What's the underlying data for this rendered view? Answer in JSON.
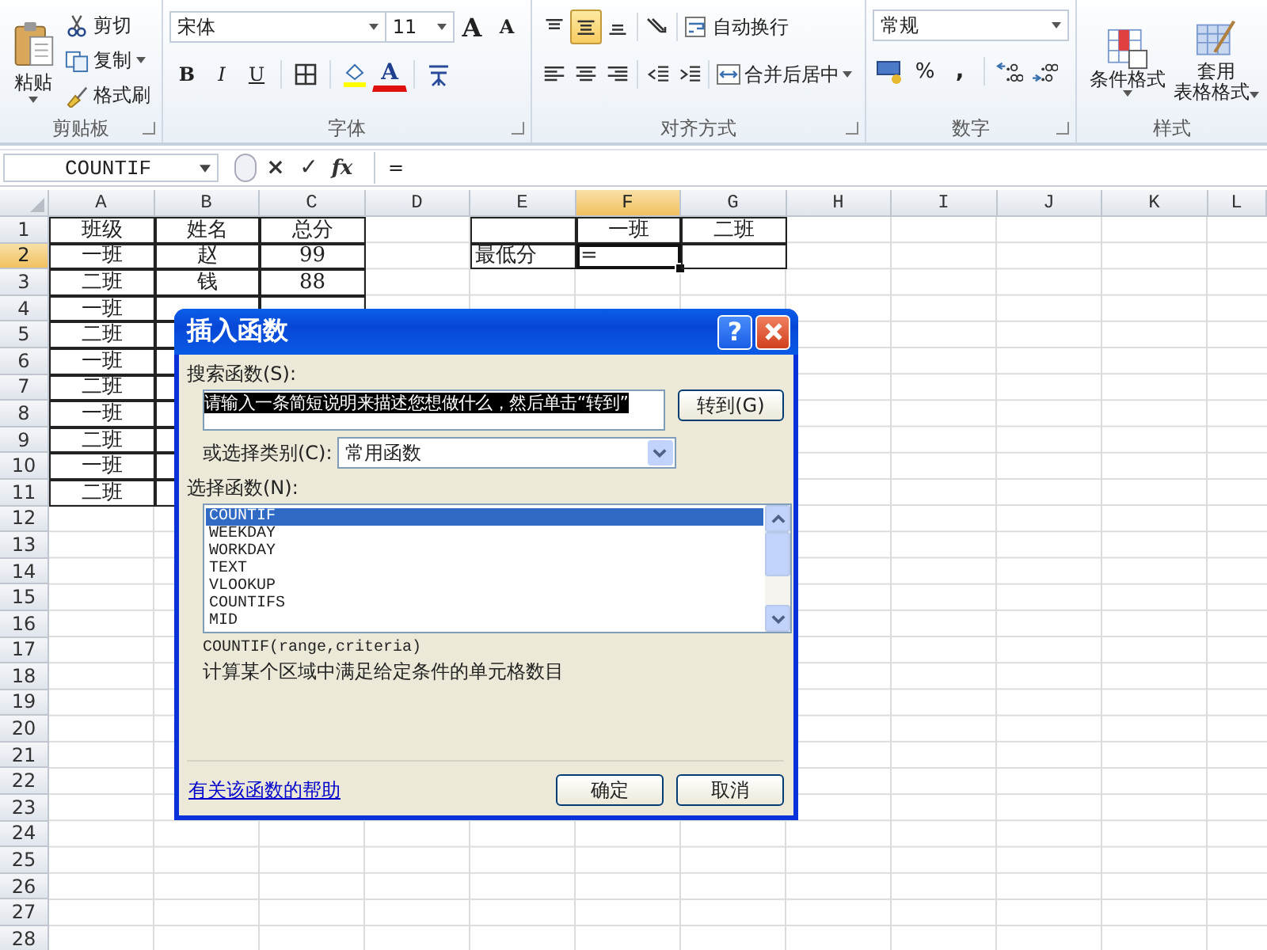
{
  "ribbon": {
    "clipboard": {
      "label": "剪贴板",
      "paste": "粘贴",
      "cut": "剪切",
      "copy": "复制",
      "painter": "格式刷"
    },
    "font": {
      "label": "字体",
      "font_name": "宋体",
      "font_size": "11",
      "grow": "A",
      "shrink": "A",
      "bold": "B",
      "italic": "I",
      "underline": "U",
      "font_color": "A"
    },
    "alignment": {
      "label": "对齐方式",
      "vertical": [
        {
          "kind": "top",
          "selected": false
        },
        {
          "kind": "middle",
          "selected": true
        },
        {
          "kind": "bottom",
          "selected": false
        }
      ],
      "horizontal": [
        {
          "kind": "left",
          "selected": false
        },
        {
          "kind": "center",
          "selected": false
        },
        {
          "kind": "right",
          "selected": false
        }
      ],
      "wrap": "自动换行",
      "merge": "合并后居中"
    },
    "number": {
      "label": "数字",
      "format": "常规",
      "percent": "%",
      "comma": ","
    },
    "styles": {
      "label": "样式",
      "conditional": "条件格式",
      "table_format": [
        "套用",
        "表格格式"
      ]
    }
  },
  "formula_bar": {
    "name_box": "COUNTIF",
    "cancel": "×",
    "enter": "✓",
    "fx": "fx",
    "formula": "="
  },
  "sheet": {
    "columns": [
      {
        "letter": "A",
        "selected": false
      },
      {
        "letter": "B",
        "selected": false
      },
      {
        "letter": "C",
        "selected": false
      },
      {
        "letter": "D",
        "selected": false
      },
      {
        "letter": "E",
        "selected": false
      },
      {
        "letter": "F",
        "selected": true
      },
      {
        "letter": "G",
        "selected": false
      },
      {
        "letter": "H",
        "selected": false
      },
      {
        "letter": "I",
        "selected": false
      },
      {
        "letter": "J",
        "selected": false
      },
      {
        "letter": "K",
        "selected": false
      },
      {
        "letter": "L",
        "selected": false
      }
    ],
    "rows": [
      {
        "number": "1",
        "selected": false,
        "cells": [
          {
            "text": "班级",
            "bordered": true,
            "active": false
          },
          {
            "text": "姓名",
            "bordered": true,
            "active": false
          },
          {
            "text": "总分",
            "bordered": true,
            "active": false
          },
          {
            "bordered": false,
            "active": false
          },
          {
            "bordered": true,
            "active": false
          },
          {
            "text": "一班",
            "bordered": true,
            "active": false
          },
          {
            "text": "二班",
            "bordered": true,
            "active": false
          }
        ]
      },
      {
        "number": "2",
        "selected": true,
        "cells": [
          {
            "text": "一班",
            "bordered": true,
            "active": false
          },
          {
            "text": "赵",
            "bordered": true,
            "active": false
          },
          {
            "text": "99",
            "bordered": true,
            "active": false
          },
          {
            "bordered": false,
            "active": false
          },
          {
            "text": "最低分",
            "bordered": true,
            "active": false
          },
          {
            "text": "=",
            "bordered": true,
            "active": true
          },
          {
            "bordered": true,
            "active": false
          }
        ]
      },
      {
        "number": "3",
        "selected": false,
        "cells": [
          {
            "text": "二班",
            "bordered": true,
            "active": false
          },
          {
            "text": "钱",
            "bordered": true,
            "active": false
          },
          {
            "text": "88",
            "bordered": true,
            "active": false
          }
        ]
      },
      {
        "number": "4",
        "selected": false,
        "cells": [
          {
            "text": "一班",
            "bordered": true,
            "active": false
          },
          {
            "bordered": true,
            "active": false
          },
          {
            "bordered": true,
            "active": false
          }
        ]
      },
      {
        "number": "5",
        "selected": false,
        "cells": [
          {
            "text": "二班",
            "bordered": true,
            "active": false
          },
          {
            "bordered": true,
            "active": false
          }
        ]
      },
      {
        "number": "6",
        "selected": false,
        "cells": [
          {
            "text": "一班",
            "bordered": true,
            "active": false
          },
          {
            "bordered": true,
            "active": false
          }
        ]
      },
      {
        "number": "7",
        "selected": false,
        "cells": [
          {
            "text": "二班",
            "bordered": true,
            "active": false
          },
          {
            "bordered": true,
            "active": false
          }
        ]
      },
      {
        "number": "8",
        "selected": false,
        "cells": [
          {
            "text": "一班",
            "bordered": true,
            "active": false
          },
          {
            "bordered": true,
            "active": false
          }
        ]
      },
      {
        "number": "9",
        "selected": false,
        "cells": [
          {
            "text": "二班",
            "bordered": true,
            "active": false
          },
          {
            "bordered": true,
            "active": false
          }
        ]
      },
      {
        "number": "10",
        "selected": false,
        "cells": [
          {
            "text": "一班",
            "bordered": true,
            "active": false
          },
          {
            "bordered": true,
            "active": false
          }
        ]
      },
      {
        "number": "11",
        "selected": false,
        "cells": [
          {
            "text": "二班",
            "bordered": true,
            "active": false
          },
          {
            "bordered": true,
            "active": false
          }
        ]
      },
      {
        "number": "12",
        "selected": false
      },
      {
        "number": "13",
        "selected": false
      },
      {
        "number": "14",
        "selected": false
      },
      {
        "number": "15",
        "selected": false
      },
      {
        "number": "16",
        "selected": false
      },
      {
        "number": "17",
        "selected": false
      },
      {
        "number": "18",
        "selected": false
      },
      {
        "number": "19",
        "selected": false
      },
      {
        "number": "20",
        "selected": false
      },
      {
        "number": "21",
        "selected": false
      },
      {
        "number": "22",
        "selected": false
      },
      {
        "number": "23",
        "selected": false
      },
      {
        "number": "24",
        "selected": false
      },
      {
        "number": "25",
        "selected": false
      },
      {
        "number": "26",
        "selected": false
      },
      {
        "number": "27",
        "selected": false
      },
      {
        "number": "28",
        "selected": false
      }
    ]
  },
  "dialog": {
    "title": "插入函数",
    "help": "?",
    "search_label": "搜索函数(S):",
    "search_value": "请输入一条简短说明来描述您想做什么，然后单击“转到”",
    "go": "转到(G)",
    "category_label": "或选择类别(C):",
    "category": "常用函数",
    "function_label": "选择函数(N):",
    "functions": [
      {
        "name": "COUNTIF",
        "selected": true
      },
      {
        "name": "WEEKDAY",
        "selected": false
      },
      {
        "name": "WORKDAY",
        "selected": false
      },
      {
        "name": "TEXT",
        "selected": false
      },
      {
        "name": "VLOOKUP",
        "selected": false
      },
      {
        "name": "COUNTIFS",
        "selected": false
      },
      {
        "name": "MID",
        "selected": false
      }
    ],
    "signature": "COUNTIF(range,criteria)",
    "description": "计算某个区域中满足给定条件的单元格数目",
    "help_link": "有关该函数的帮助",
    "ok": "确定",
    "cancel": "取消"
  }
}
